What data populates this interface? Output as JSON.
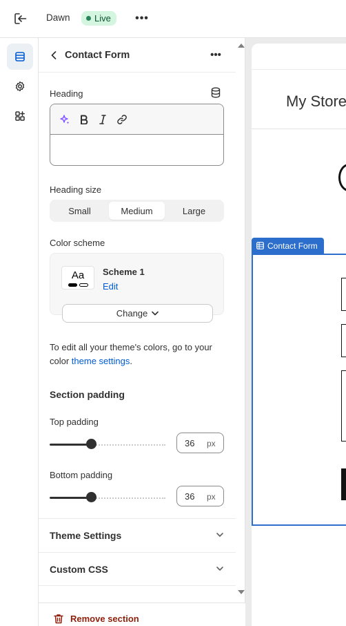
{
  "topbar": {
    "store_name": "Dawn",
    "status_badge": "Live",
    "more_label": "•••"
  },
  "panel": {
    "title": "Contact Form",
    "more_label": "•••",
    "heading": {
      "label": "Heading",
      "value": ""
    },
    "heading_size": {
      "label": "Heading size",
      "options": [
        "Small",
        "Medium",
        "Large"
      ],
      "selected": "Medium"
    },
    "color_scheme": {
      "label": "Color scheme",
      "swatch_text": "Aa",
      "scheme_name": "Scheme 1",
      "edit_label": "Edit",
      "change_label": "Change",
      "help_prefix": "To edit all your theme's colors, go to your color ",
      "help_link": "theme settings",
      "help_suffix": "."
    },
    "section_padding": {
      "title": "Section padding",
      "top_label": "Top padding",
      "top_value": "36",
      "bottom_label": "Bottom padding",
      "bottom_value": "36",
      "unit": "px",
      "slider_fraction": 0.36
    },
    "accordions": [
      "Theme Settings",
      "Custom CSS"
    ],
    "remove_label": "Remove section"
  },
  "preview": {
    "store_title": "My Store",
    "section_tag": "Contact Form"
  },
  "colors": {
    "accent_blue": "#2c6ecb",
    "link_blue": "#005bd3",
    "live_green": "#29845a",
    "critical_red": "#8e1f0b"
  }
}
